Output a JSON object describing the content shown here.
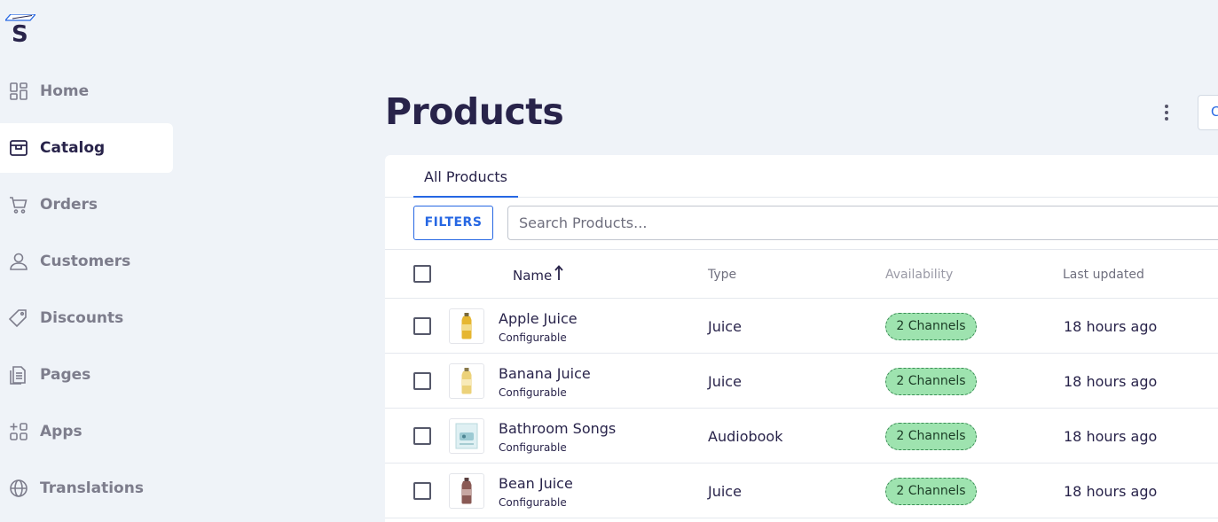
{
  "logo": {
    "letter": "S"
  },
  "sidebar": {
    "items": [
      {
        "label": "Home",
        "icon": "home-grid-icon",
        "active": false
      },
      {
        "label": "Catalog",
        "icon": "catalog-box-icon",
        "active": true
      },
      {
        "label": "Orders",
        "icon": "cart-icon",
        "active": false
      },
      {
        "label": "Customers",
        "icon": "user-icon",
        "active": false
      },
      {
        "label": "Discounts",
        "icon": "tag-icon",
        "active": false
      },
      {
        "label": "Pages",
        "icon": "document-icon",
        "active": false
      },
      {
        "label": "Apps",
        "icon": "apps-grid-icon",
        "active": false
      },
      {
        "label": "Translations",
        "icon": "globe-icon",
        "active": false
      }
    ]
  },
  "header": {
    "title": "Products",
    "create_label": "C"
  },
  "tabs": {
    "all_products": "All Products"
  },
  "toolbar": {
    "filters_label": "FILTERS",
    "search_placeholder": "Search Products..."
  },
  "table": {
    "columns": {
      "name": "Name",
      "type": "Type",
      "availability": "Availability",
      "last_updated": "Last updated"
    },
    "rows": [
      {
        "name": "Apple Juice",
        "subtitle": "Configurable",
        "type": "Juice",
        "availability": "2 Channels",
        "updated": "18 hours ago",
        "thumb": "yellow-bottle"
      },
      {
        "name": "Banana Juice",
        "subtitle": "Configurable",
        "type": "Juice",
        "availability": "2 Channels",
        "updated": "18 hours ago",
        "thumb": "pale-bottle"
      },
      {
        "name": "Bathroom Songs",
        "subtitle": "Configurable",
        "type": "Audiobook",
        "availability": "2 Channels",
        "updated": "18 hours ago",
        "thumb": "audiobook-cover"
      },
      {
        "name": "Bean Juice",
        "subtitle": "Configurable",
        "type": "Juice",
        "availability": "2 Channels",
        "updated": "18 hours ago",
        "thumb": "brown-bottle"
      }
    ]
  },
  "colors": {
    "accent": "#2667e3",
    "badge_bg": "#9ee3af",
    "text": "#28234a",
    "page_bg": "#eff3f8"
  }
}
